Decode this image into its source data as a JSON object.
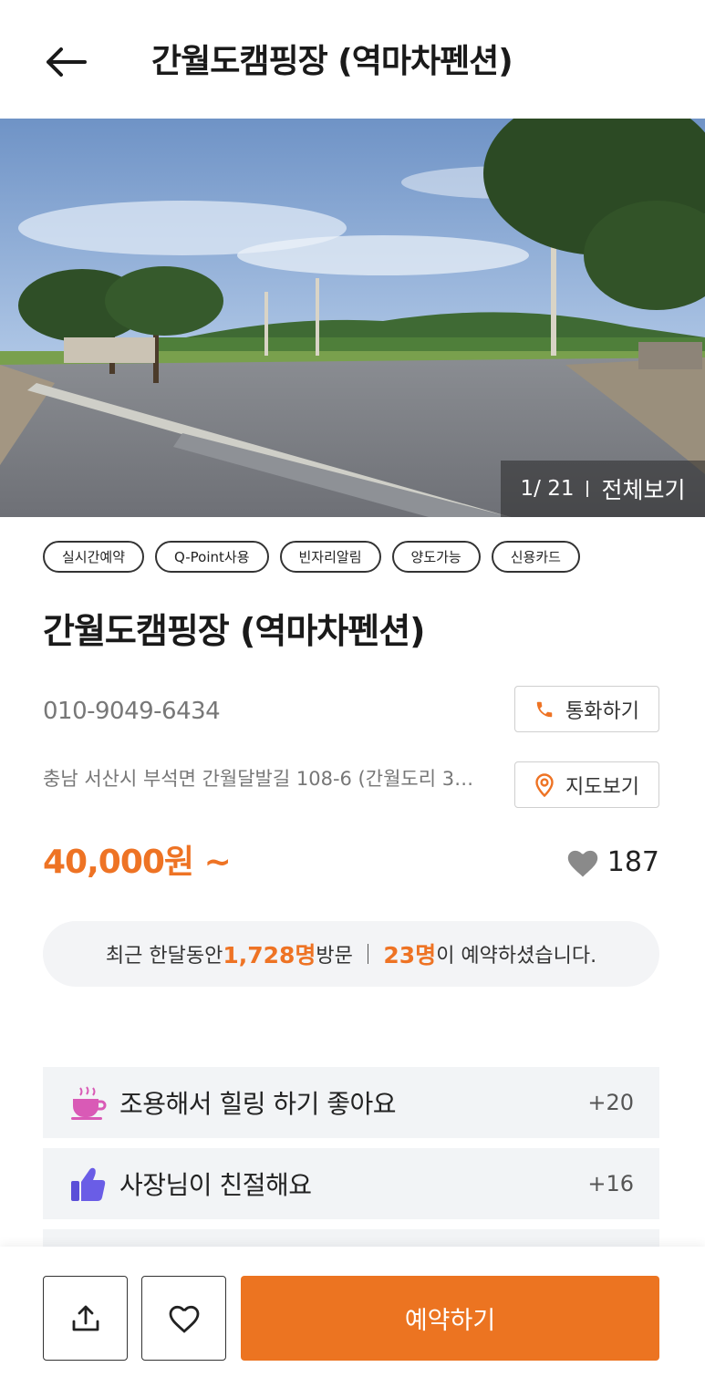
{
  "header": {
    "title": "간월도캠핑장 (역마차펜션)",
    "back_icon": "arrow-left-icon"
  },
  "photo": {
    "current": "1",
    "total": "21",
    "counter_text": "1/ 21",
    "view_all_label": "전체보기"
  },
  "tags": [
    "실시간예약",
    "Q-Point사용",
    "빈자리알림",
    "양도가능",
    "신용카드"
  ],
  "place": {
    "name": "간월도캠핑장 (역마차펜션)",
    "phone": "010-9049-6434",
    "address": "충남 서산시 부석면 간월달발길 108-6 (간월도리 3…)",
    "call_label": "통화하기",
    "map_label": "지도보기",
    "price": "40,000원 ~",
    "likes": "187"
  },
  "visits": {
    "prefix": "최근 한달동안 ",
    "visitors": "1,728명",
    "visitors_suffix": "방문",
    "reservations": "23명",
    "reservations_suffix": "이 예약하셨습니다."
  },
  "reviews": [
    {
      "label": "조용해서 힐링 하기 좋아요",
      "count": "+20",
      "icon": "coffee-cup-icon"
    },
    {
      "label": "사장님이 친절해요",
      "count": "+16",
      "icon": "thumbs-up-icon"
    }
  ],
  "bottom": {
    "reserve_label": "예약하기",
    "share_icon": "share-icon",
    "wish_icon": "heart-outline-icon"
  },
  "colors": {
    "accent": "#ee7324",
    "reserve_button": "#ec7421",
    "panel_bg": "#f2f4f6"
  }
}
